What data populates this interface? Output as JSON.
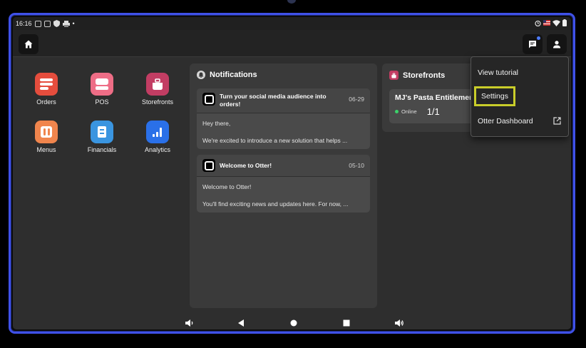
{
  "status_bar": {
    "time": "16:16",
    "dot": "•"
  },
  "top_bar": {
    "home_icon": "home-icon",
    "messages_icon": "message-icon",
    "user_icon": "user-icon"
  },
  "apps": [
    {
      "label": "Orders",
      "icon": "orders-icon",
      "color": "#e54d3d"
    },
    {
      "label": "POS",
      "icon": "pos-icon",
      "color": "#ee6d86"
    },
    {
      "label": "Storefronts",
      "icon": "storefront-icon",
      "color": "#c23d63"
    },
    {
      "label": "Menus",
      "icon": "menus-icon",
      "color": "#f0854d"
    },
    {
      "label": "Financials",
      "icon": "financials-icon",
      "color": "#3a95e0"
    },
    {
      "label": "Analytics",
      "icon": "analytics-icon",
      "color": "#2a70e8"
    }
  ],
  "notifications": {
    "title": "Notifications",
    "items": [
      {
        "title": "Turn your social media audience into orders!",
        "date": "06-29",
        "line1": "Hey there,",
        "line2": "We're excited to introduce a new solution that helps ..."
      },
      {
        "title": "Welcome to Otter!",
        "date": "05-10",
        "line1": "Welcome to Otter!",
        "line2": "You'll find exciting news and updates here. For now, ..."
      }
    ]
  },
  "storefronts": {
    "title": "Storefronts",
    "store_name": "MJ's Pasta Entitlement",
    "status": "Online",
    "count": "1/1"
  },
  "menu": {
    "view_tutorial": "View tutorial",
    "settings": "Settings",
    "otter_dashboard": "Otter Dashboard"
  },
  "colors": {
    "highlight": "#c9cd2a",
    "frame": "#3f51e8",
    "accent_dot": "#4d7cff",
    "online": "#3bd26a"
  }
}
